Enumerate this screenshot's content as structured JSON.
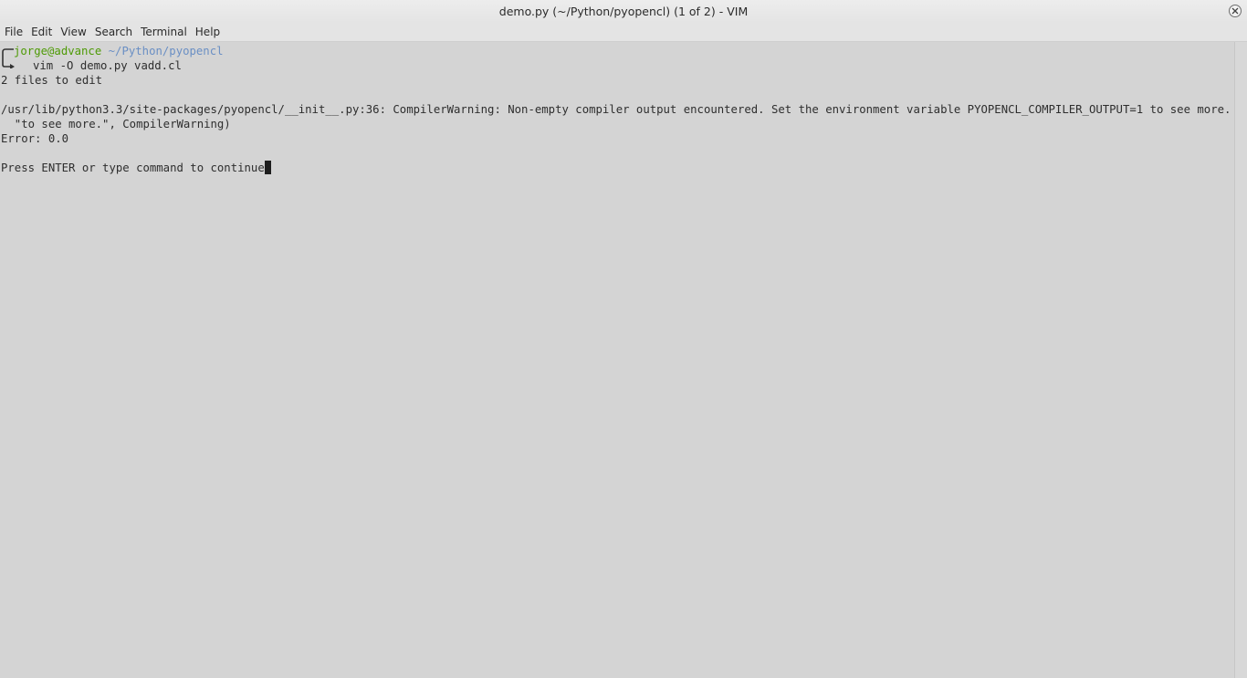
{
  "window": {
    "title": "demo.py (~/Python/pyopencl) (1 of 2) - VIM"
  },
  "menu": {
    "items": [
      "File",
      "Edit",
      "View",
      "Search",
      "Terminal",
      "Help"
    ]
  },
  "terminal": {
    "prompt_user_host": "jorge@advance",
    "prompt_path": "~/Python/pyopencl",
    "command": "vim -O demo.py vadd.cl",
    "lines": [
      "2 files to edit",
      "",
      "/usr/lib/python3.3/site-packages/pyopencl/__init__.py:36: CompilerWarning: Non-empty compiler output encountered. Set the environment variable PYOPENCL_COMPILER_OUTPUT=1 to see more.",
      "  \"to see more.\", CompilerWarning)",
      "Error: 0.0",
      "",
      "Press ENTER or type command to continue"
    ]
  },
  "colors": {
    "background": "#d4d4d4",
    "prompt_user": "#4e9a06",
    "prompt_path": "#6a8fc4",
    "text": "#2e2e2e"
  }
}
